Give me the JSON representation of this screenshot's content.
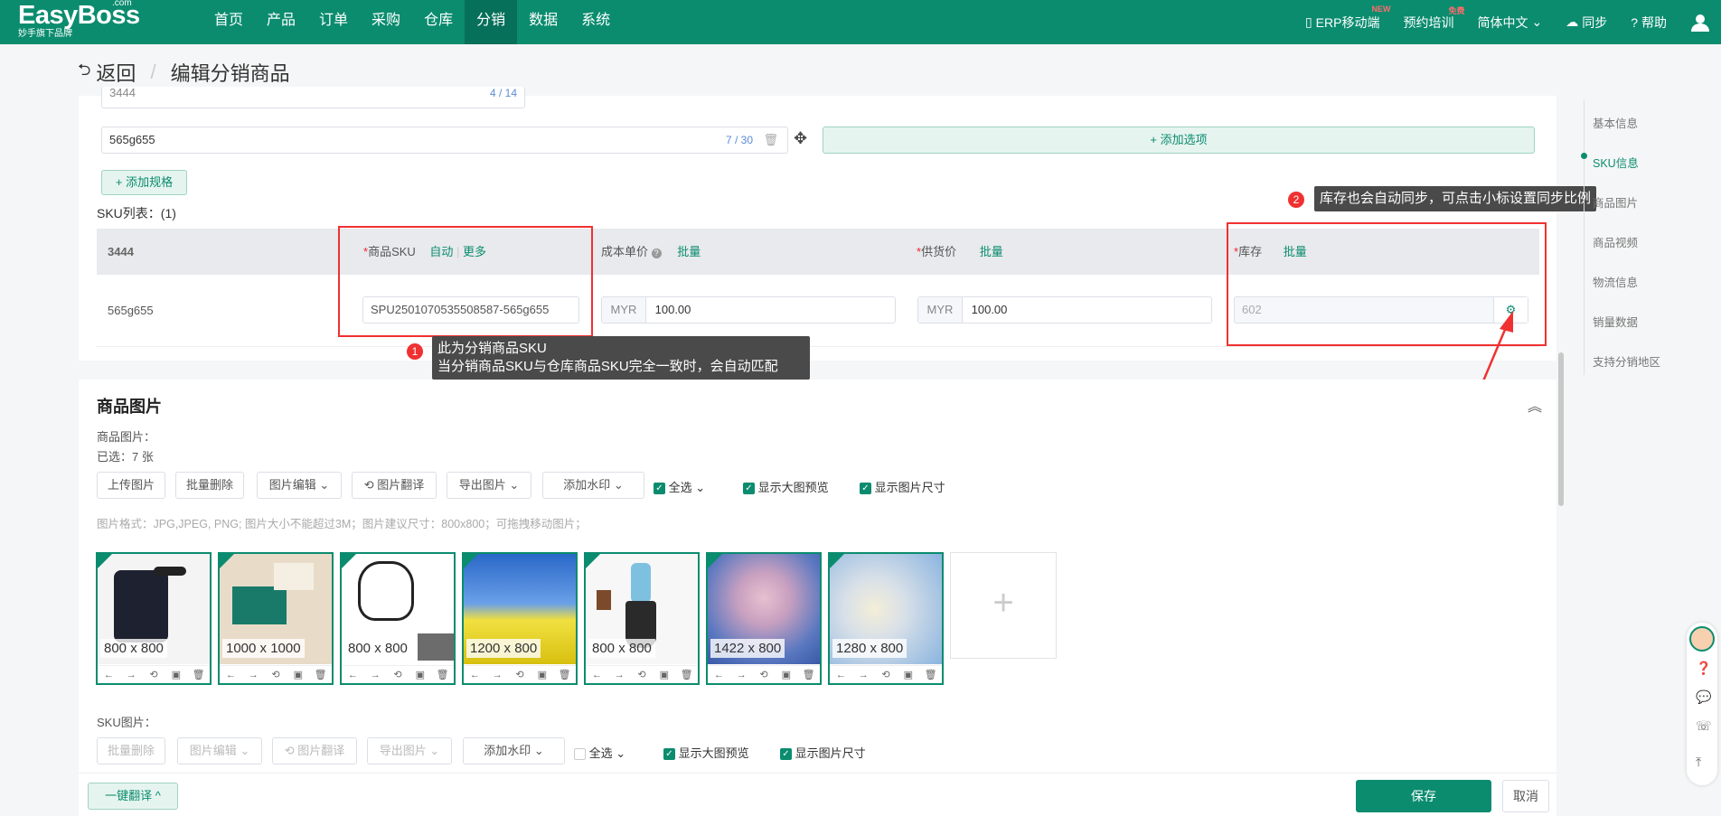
{
  "header": {
    "logo": "EasyBoss",
    "logo_com": ".com",
    "logo_sub": "妙手旗下品牌",
    "nav": [
      "首页",
      "产品",
      "订单",
      "采购",
      "仓库",
      "分销",
      "数据",
      "系统"
    ],
    "active_nav": "分销",
    "right": {
      "erp": "ERP移动端",
      "erp_tag": "NEW",
      "train": "预约培训",
      "train_tag": "免费",
      "lang": "简体中文",
      "sync": "同步",
      "help": "帮助"
    }
  },
  "breadcrumb": {
    "back": "返回",
    "title": "编辑分销商品"
  },
  "spec": {
    "partial_value": "3444",
    "partial_count": "4 / 14",
    "option_value": "565g655",
    "option_count": "7 / 30",
    "add_option": "+ 添加选项",
    "add_spec": "+ 添加规格"
  },
  "sku": {
    "list_label": "SKU列表：(1)",
    "headers": {
      "spec": "3444",
      "sku": "商品SKU",
      "sku_auto": "自动",
      "sku_more": "更多",
      "cost": "成本单价",
      "cost_batch": "批量",
      "supply": "供货价",
      "supply_batch": "批量",
      "stock": "库存",
      "stock_batch": "批量"
    },
    "row": {
      "spec": "565g655",
      "sku": "SPU2501070535508587-565g655",
      "cost_currency": "MYR",
      "cost": "100.00",
      "supply_currency": "MYR",
      "supply": "100.00",
      "stock": "602"
    }
  },
  "annotations": {
    "tip1_num": "1",
    "tip1_line1": "此为分销商品SKU",
    "tip1_line2": "当分销商品SKU与仓库商品SKU完全一致时，会自动匹配",
    "tip2_num": "2",
    "tip2_text": "库存也会自动同步，可点击小标设置同步比例"
  },
  "images": {
    "title": "商品图片",
    "label": "商品图片：",
    "selected": "已选：7 张",
    "toolbar": [
      "上传图片",
      "批量删除",
      "图片编辑",
      "图片翻译",
      "导出图片",
      "添加水印"
    ],
    "select_all": "全选",
    "big_preview": "显示大图预览",
    "show_size": "显示图片尺寸",
    "hint": "图片格式：JPG,JPEG, PNG; 图片大小不能超过3M；图片建议尺寸：800x800；可拖拽移动图片；",
    "items": [
      {
        "size": "800 x 800"
      },
      {
        "size": "1000 x 1000"
      },
      {
        "size": "800 x 800"
      },
      {
        "size": "1200 x 800"
      },
      {
        "size": "800 x 800"
      },
      {
        "size": "1422 x 800"
      },
      {
        "size": "1280 x 800"
      }
    ]
  },
  "sku_images": {
    "label": "SKU图片：",
    "toolbar": [
      "批量删除",
      "图片编辑",
      "图片翻译",
      "导出图片",
      "添加水印"
    ],
    "select_all": "全选",
    "big_preview": "显示大图预览",
    "show_size": "显示图片尺寸"
  },
  "right_nav": [
    "基本信息",
    "SKU信息",
    "商品图片",
    "商品视频",
    "物流信息",
    "销量数据",
    "支持分销地区"
  ],
  "footer": {
    "translate": "一键翻译",
    "save": "保存",
    "cancel": "取消"
  },
  "colors": {
    "brand": "#0b8c6f",
    "annotation": "#f03131"
  }
}
